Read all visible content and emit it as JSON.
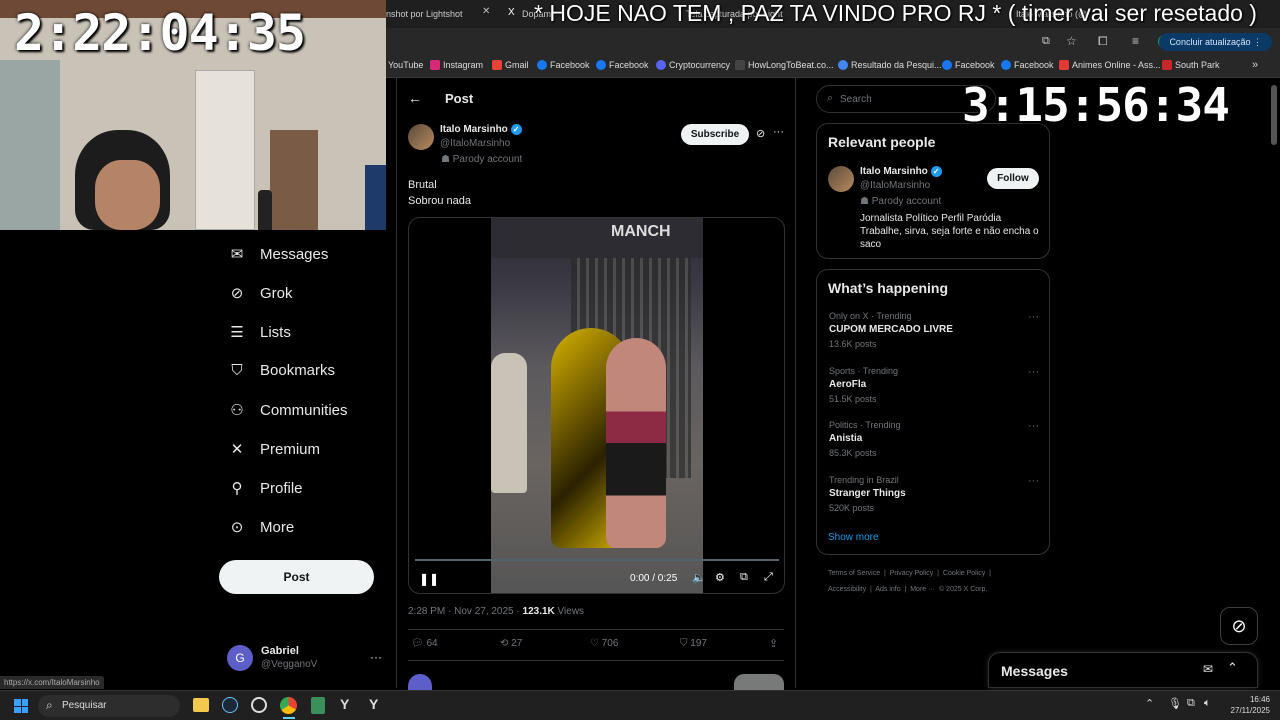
{
  "overlay": {
    "timer_left": "2:22:04:35",
    "timer_right": "3:15:56:34",
    "banner": "* HOJE NAO TEM , PAZ TA VINDO PRO RJ * ( timer vai ser resetado )"
  },
  "browser": {
    "tabs": [
      {
        "label": "nshot por Lightshot"
      },
      {
        "label": "Dopami"
      },
      {
        "label": "or Lightshot"
      },
      {
        "label": "Tela capturada por Light"
      },
      {
        "label": "Italo Marsinho (@"
      }
    ],
    "update_button": "Concluir atualização",
    "bookmarks": [
      {
        "label": "YouTube",
        "color": "#ff0000"
      },
      {
        "label": "Instagram",
        "color": "#d62976"
      },
      {
        "label": "Gmail",
        "color": "#ea4335"
      },
      {
        "label": "Facebook",
        "color": "#1877f2"
      },
      {
        "label": "Facebook",
        "color": "#1877f2"
      },
      {
        "label": "Cryptocurrency",
        "color": "#5865f2"
      },
      {
        "label": "HowLongToBeat.co...",
        "color": "#222222"
      },
      {
        "label": "Resultado da Pesqui...",
        "color": "#4285f4"
      },
      {
        "label": "Facebook",
        "color": "#1877f2"
      },
      {
        "label": "Facebook",
        "color": "#1877f2"
      },
      {
        "label": "Animes Online - Ass...",
        "color": "#e53935"
      },
      {
        "label": "South Park",
        "color": "#c62828"
      }
    ],
    "status_url": "https://x.com/ItaloMarsinho"
  },
  "nav": {
    "items": [
      {
        "label": "Messages",
        "icon": "envelope-icon"
      },
      {
        "label": "Grok",
        "icon": "grok-icon"
      },
      {
        "label": "Lists",
        "icon": "list-icon"
      },
      {
        "label": "Bookmarks",
        "icon": "bookmark-icon"
      },
      {
        "label": "Communities",
        "icon": "communities-icon"
      },
      {
        "label": "Premium",
        "icon": "x-logo-icon"
      },
      {
        "label": "Profile",
        "icon": "person-icon"
      },
      {
        "label": "More",
        "icon": "more-circle-icon"
      }
    ],
    "post_button": "Post",
    "account": {
      "name": "Gabriel",
      "handle": "@VegganoV",
      "initial": "G"
    }
  },
  "post": {
    "header": "Post",
    "author_name": "Italo Marsinho",
    "author_handle": "@ItaloMarsinho",
    "parody_label": "Parody account",
    "subscribe": "Subscribe",
    "text_line1": "Brutal",
    "text_line2": "Sobrou nada",
    "video_time": "0:00 / 0:25",
    "video_progress": 0.0,
    "timestamp": "2:28 PM · Nov 27, 2025 · ",
    "views_count": "123.1K",
    "views_label": " Views",
    "replies": "64",
    "reposts": "27",
    "likes": "706",
    "bookmarks": "197"
  },
  "sidebar": {
    "search_placeholder": "Search",
    "relevant_title": "Relevant people",
    "person": {
      "name": "Italo Marsinho",
      "handle": "@ItaloMarsinho",
      "parody": "Parody account",
      "bio": "Jornalista Político Perfil Paródia Trabalhe, sirva, seja forte e não encha o saco",
      "follow": "Follow"
    },
    "happening_title": "What’s happening",
    "trends": [
      {
        "category": "Only on X · Trending",
        "name": "CUPOM MERCADO LIVRE",
        "count": "13.6K posts"
      },
      {
        "category": "Sports · Trending",
        "name": "AeroFla",
        "count": "51.5K posts"
      },
      {
        "category": "Politics · Trending",
        "name": "Anistia",
        "count": "85.3K posts"
      },
      {
        "category": "Trending in Brazil",
        "name": "Stranger Things",
        "count": "520K posts"
      }
    ],
    "show_more": "Show more",
    "footer_line1": "Terms of Service  |  Privacy Policy  |  Cookie Policy  |",
    "footer_line2": "Accessibility  |  Ads info  |  More ···  © 2025 X Corp.",
    "messages_drawer": "Messages"
  },
  "taskbar": {
    "search_placeholder": "Pesquisar",
    "time": "16:46",
    "date": "27/11/2025"
  }
}
